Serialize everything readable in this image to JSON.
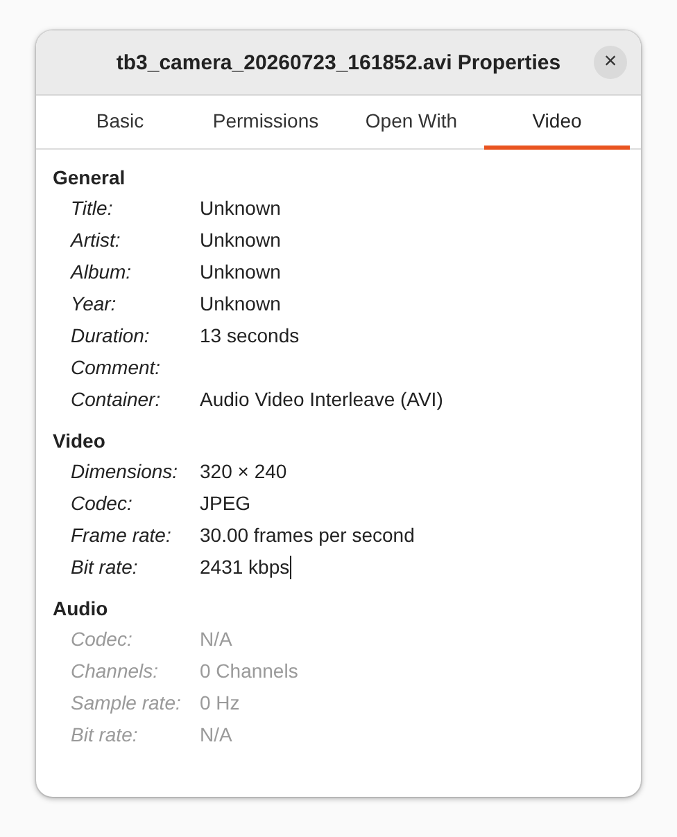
{
  "window": {
    "title": "tb3_camera_20260723_161852.avi Properties",
    "close": "×"
  },
  "tabs": [
    {
      "label": "Basic",
      "selected": false
    },
    {
      "label": "Permissions",
      "selected": false
    },
    {
      "label": "Open With",
      "selected": false
    },
    {
      "label": "Video",
      "selected": true
    }
  ],
  "sections": [
    {
      "heading": "General",
      "disabled": false,
      "rows": [
        {
          "label": "Title:",
          "value": "Unknown"
        },
        {
          "label": "Artist:",
          "value": "Unknown"
        },
        {
          "label": "Album:",
          "value": "Unknown"
        },
        {
          "label": "Year:",
          "value": "Unknown"
        },
        {
          "label": "Duration:",
          "value": "13 seconds"
        },
        {
          "label": "Comment:"
        },
        {
          "label": "Container:",
          "value": "Audio Video Interleave (AVI)"
        }
      ]
    },
    {
      "heading": "Video",
      "disabled": false,
      "rows": [
        {
          "label": "Dimensions:",
          "value": "320 × 240"
        },
        {
          "label": "Codec:",
          "value": "JPEG"
        },
        {
          "label": "Frame rate:",
          "value": "30.00 frames per second"
        },
        {
          "label": "Bit rate:",
          "value": "2431 kbps",
          "caret": true
        }
      ]
    },
    {
      "heading": "Audio",
      "disabled": true,
      "rows": [
        {
          "label": "Codec:",
          "value": "N/A"
        },
        {
          "label": "Channels:",
          "value": "0 Channels"
        },
        {
          "label": "Sample rate:",
          "value": "0 Hz"
        },
        {
          "label": "Bit rate:",
          "value": "N/A"
        }
      ]
    }
  ]
}
